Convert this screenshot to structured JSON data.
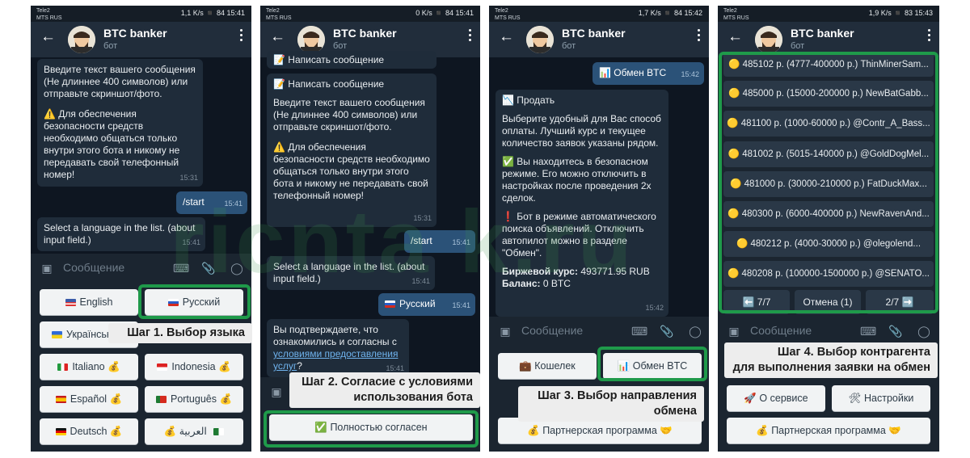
{
  "common": {
    "bot_title": "BTC banker",
    "bot_subtitle": "бот",
    "input_placeholder": "Сообщение",
    "carrier_top": "Tele2",
    "carrier_bottom": "MTS RUS"
  },
  "panel1": {
    "status_right": "1,1 K/s  ◾  84  15:41",
    "msg_intro": "Введите текст вашего сообщения (Не длиннее 400 символов) или отправьте скриншот/фото.",
    "msg_warning": "⚠️ Для обеспечения безопасности средств необходимо общаться только внутри этого бота и никому не передавать свой телефонный номер!",
    "msg_time": "15:31",
    "out_start": "/start",
    "out_start_time": "15:41",
    "msg_lang": "Select a language in the list. (about input field.)",
    "msg_lang_time": "15:41",
    "btn_english": "English",
    "btn_russian": "Русский",
    "btn_ukrainian": "Українськ",
    "btn_italiano": "Italiano 💰",
    "btn_indonesia": "Indonesia 💰",
    "btn_espanol": "Español 💰",
    "btn_portugues": "Português 💰",
    "btn_deutsch": "Deutsch 💰",
    "btn_arabic": "💰 العربية",
    "caption": "Шаг 1. Выбор языка"
  },
  "panel2": {
    "status_right": "0 K/s  ◾  84  15:41",
    "msg_top_cut": "📝 Написать сообщение",
    "msg_write_title": "📝 Написать сообщение",
    "msg_intro": "Введите текст вашего сообщения (Не длиннее 400 символов) или отправьте скриншот/фото.",
    "msg_warning": "⚠️ Для обеспечения безопасности средств необходимо общаться только внутри этого бота и никому не передавать свой телефонный номер!",
    "msg_time": "15:31",
    "out_start": "/start",
    "out_start_time": "15:41",
    "msg_lang": "Select a language in the list. (about input field.)",
    "msg_lang_time": "15:41",
    "out_russian": "Русский",
    "out_russian_time": "15:41",
    "msg_confirm_pre": "Вы подтверждаете, что ознакомились и согласны с",
    "msg_confirm_link": "условиями предоставления услуг",
    "msg_confirm_post": "?",
    "msg_confirm_time": "15:41",
    "btn_agree": "✅ Полностью согласен",
    "caption_line1": "Шаг 2. Согласие с условиями",
    "caption_line2": "использования бота"
  },
  "panel3": {
    "status_right": "1,7 K/s  ◾  84  15:42",
    "out_exchange": "📊 Обмен BTC",
    "out_exchange_time": "15:42",
    "msg_sell_title": "📉 Продать",
    "msg_sell_body": "Выберите удобный для Вас способ оплаты. Лучший курс и текущее количество заявок указаны рядом.",
    "msg_safe": "✅ Вы находитесь в безопасном режиме. Его можно отключить в настройках после проведения 2х сделок.",
    "msg_auto": "❗ Бот в режиме автоматического поиска объявлений. Отключить автопилот можно в разделе \"Обмен\".",
    "rate_label": "Биржевой курс:",
    "rate_value": "493771.95 RUB",
    "balance_label": "Баланс:",
    "balance_value": "0 BTC",
    "msg_time": "15:42",
    "btn_wallet": "💼 Кошелек",
    "btn_exchange": "📊 Обмен BTC",
    "btn_partner": "💰 Партнерская программа 🤝",
    "caption_line1": "Шаг 3. Выбор направления",
    "caption_line2": "обмена"
  },
  "panel4": {
    "status_right": "1,9 K/s  ◾  83  15:43",
    "offers": [
      "🟡 485102 р. (4777-400000 р.) ThinMinerSam...",
      "🟡 485000 р. (15000-200000 р.) NewBatGabb...",
      "🟡 481100 р. (1000-60000 р.) @Contr_A_Bass...",
      "🟡 481002 р. (5015-140000 р.) @GoldDogMel...",
      "🟡 481000 р. (30000-210000 р.) FatDuckMax...",
      "🟡 480300 р. (6000-400000 р.) NewRavenAnd...",
      "🟡 480212 р. (4000-30000 р.) @olegolend...",
      "🟡 480208 р. (100000-1500000 р.) @SENATO..."
    ],
    "nav_prev": "⬅️ 7/7",
    "nav_cancel": "Отмена (1)",
    "nav_next": "2/7 ➡️",
    "btn_about": "🚀 О сервисе",
    "btn_settings": "🛠 Настройки",
    "btn_partner": "💰 Партнерская программа 🤝",
    "caption_line1": "Шаг 4. Выбор контрагента",
    "caption_line2": "для выполнения заявки на обмен"
  },
  "watermark": "ricnta k.ru",
  "colors": {
    "highlight": "#1f9a4a",
    "chat_bg": "#0e1621",
    "bubble_in": "#1f2c3a",
    "bubble_out": "#2b5278"
  }
}
